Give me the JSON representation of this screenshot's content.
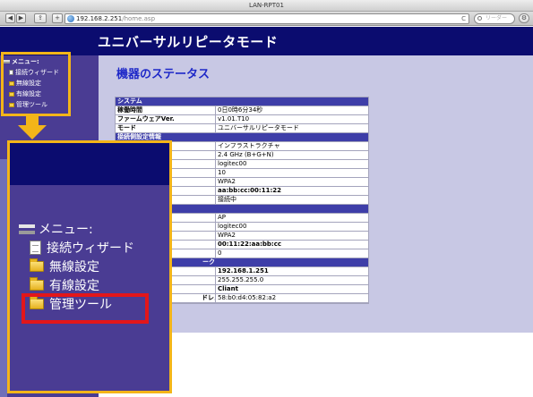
{
  "window": {
    "title": "LAN-RPT01"
  },
  "toolbar": {
    "back_glyph": "◀",
    "forward_glyph": "▶",
    "share_glyph": "⇪",
    "add_glyph": "+",
    "url_host": "192.168.2.251",
    "url_path": "/home.asp",
    "reload_glyph": "C",
    "search_placeholder": "リーダー",
    "settings_glyph": "⚙"
  },
  "banner": {
    "title": "ユニバーサルリピータモード"
  },
  "page": {
    "title": "機器のステータス"
  },
  "menu": {
    "header": "メニュー:",
    "items": [
      {
        "label": "接続ウィザード",
        "icon": "file-icon"
      },
      {
        "label": "無線設定",
        "icon": "folder-icon"
      },
      {
        "label": "有線設定",
        "icon": "folder-icon"
      },
      {
        "label": "管理ツール",
        "icon": "folder-icon"
      }
    ]
  },
  "status": {
    "system": {
      "header": "システム",
      "rows": [
        {
          "label": "稼働時間",
          "value": "0日0時6分34秒"
        },
        {
          "label": "ファームウェアVer.",
          "value": "v1.01.T10"
        },
        {
          "label": "モード",
          "value": "ユニバーサルリピータモード"
        }
      ]
    },
    "upstream": {
      "header": "接続側設定情報",
      "rows": [
        {
          "label": "",
          "value": "インフラストラクチャ"
        },
        {
          "label": "",
          "value": "2.4 GHz (B+G+N)"
        },
        {
          "label": "",
          "value": "logitec00"
        },
        {
          "label": "",
          "value": "10"
        },
        {
          "label": "",
          "value": "WPA2"
        },
        {
          "label": "",
          "value": "aa:bb:cc:00:11:22",
          "bold": true
        },
        {
          "label": "",
          "value": "接続中"
        }
      ]
    },
    "repeater": {
      "header": "",
      "rows": [
        {
          "label": "",
          "value": "AP"
        },
        {
          "label": "",
          "value": "logitec00"
        },
        {
          "label": "",
          "value": "WPA2"
        },
        {
          "label": "",
          "value": "00:11:22:aa:bb:cc",
          "bold": true
        },
        {
          "label": "",
          "value": "0"
        }
      ]
    },
    "network": {
      "header": "ーク",
      "rows": [
        {
          "label": "",
          "value": "192.168.1.251",
          "bold": true
        },
        {
          "label": "",
          "value": "255.255.255.0"
        },
        {
          "label": "",
          "value": "Cliant",
          "bold": true
        },
        {
          "label": "ドレス",
          "value": "58:b0:d4:05:82:a2"
        }
      ]
    }
  },
  "colors": {
    "banner_bg": "#0b0c6f",
    "sidebar_bg": "#4a3c93",
    "content_bg": "#c8c8e4",
    "title_blue": "#1e28c8",
    "callout_yellow": "#f3b519",
    "highlight_red": "#e3161a"
  }
}
